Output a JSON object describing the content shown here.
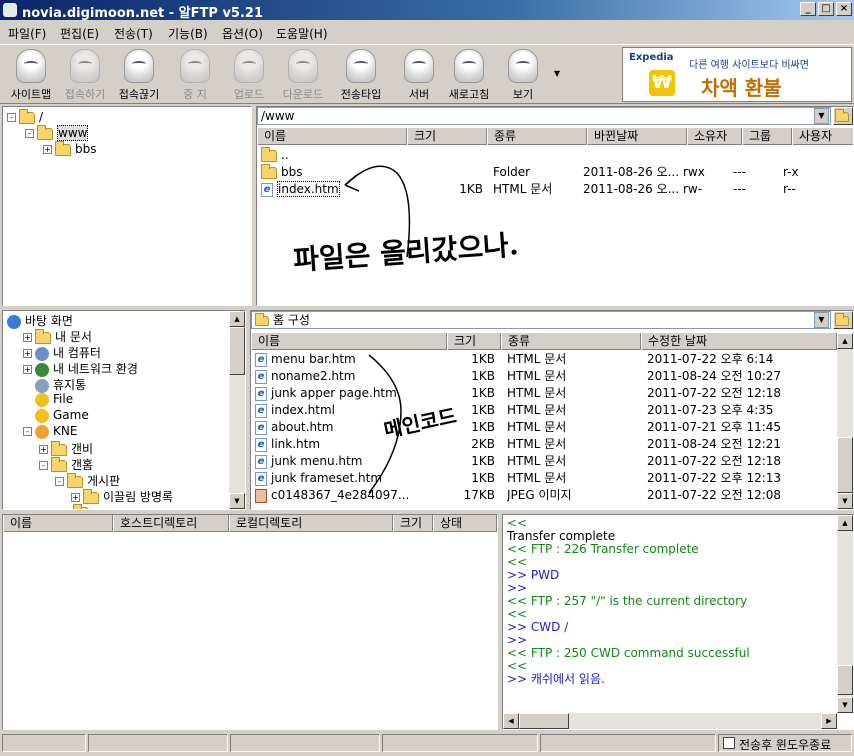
{
  "window": {
    "title": "novia.digimoon.net - 알FTP v5.21"
  },
  "menu": [
    "파일(F)",
    "편집(E)",
    "전송(T)",
    "기능(B)",
    "옵션(O)",
    "도움말(H)"
  ],
  "toolbar": [
    {
      "label": "사이트맵",
      "enabled": true
    },
    {
      "label": "접속하기",
      "enabled": false
    },
    {
      "label": "접속끊기",
      "enabled": true
    },
    {
      "label": "중 지",
      "enabled": false
    },
    {
      "label": "업로드",
      "enabled": false
    },
    {
      "label": "다운로드",
      "enabled": false
    },
    {
      "label": "전송타입",
      "enabled": true
    },
    {
      "label": "서버",
      "enabled": true
    },
    {
      "label": "새로고침",
      "enabled": true
    },
    {
      "label": "보기",
      "enabled": true
    }
  ],
  "ad": {
    "brand": "Expedia",
    "tagline": "다른 여행 사이트보다 비싸면",
    "headline": "차액 환불",
    "symbol": "₩"
  },
  "remote_tree": [
    {
      "label": "/",
      "level": 0,
      "expander": "-"
    },
    {
      "label": "www",
      "level": 1,
      "expander": "-"
    },
    {
      "label": "bbs",
      "level": 2,
      "expander": "+"
    }
  ],
  "remote": {
    "path": "/www",
    "columns": [
      "이름",
      "크기",
      "종류",
      "바뀐날짜",
      "소유자",
      "그룹",
      "사용자"
    ],
    "files": [
      {
        "name": "..",
        "size": "",
        "type": "",
        "date": "",
        "owner": "",
        "group": "",
        "user": "",
        "icon": "folder"
      },
      {
        "name": "bbs",
        "size": "",
        "type": "Folder",
        "date": "2011-08-26 오...",
        "owner": "rwx",
        "group": "---",
        "user": "r-x",
        "icon": "folder"
      },
      {
        "name": "index.htm",
        "size": "1KB",
        "type": "HTML 문서",
        "date": "2011-08-26 오...",
        "owner": "rw-",
        "group": "---",
        "user": "r--",
        "icon": "htm"
      }
    ],
    "annotation": "파일은 올리갔으나."
  },
  "local_tree": [
    {
      "label": "바탕 화면",
      "level": 0,
      "expander": "",
      "icon": "desktop"
    },
    {
      "label": "내 문서",
      "level": 1,
      "expander": "+",
      "icon": "folder"
    },
    {
      "label": "내 컴퓨터",
      "level": 1,
      "expander": "+",
      "icon": "computer"
    },
    {
      "label": "내 네트워크 환경",
      "level": 1,
      "expander": "+",
      "icon": "network"
    },
    {
      "label": "휴지통",
      "level": 1,
      "expander": "",
      "icon": "trash"
    },
    {
      "label": "File",
      "level": 1,
      "expander": "",
      "icon": "star"
    },
    {
      "label": "Game",
      "level": 1,
      "expander": "",
      "icon": "star"
    },
    {
      "label": "KNE",
      "level": 1,
      "expander": "-",
      "icon": "user"
    },
    {
      "label": "갠비",
      "level": 2,
      "expander": "+",
      "icon": "folder"
    },
    {
      "label": "갠홈",
      "level": 2,
      "expander": "-",
      "icon": "folder"
    },
    {
      "label": "게시판",
      "level": 3,
      "expander": "-",
      "icon": "folder"
    },
    {
      "label": "이끌림 방명록",
      "level": 4,
      "expander": "+",
      "icon": "folder"
    }
  ],
  "local": {
    "path": "홈 구성",
    "columns": [
      "이름",
      "크기",
      "종류",
      "수정한 날짜"
    ],
    "files": [
      {
        "name": "menu bar.htm",
        "size": "1KB",
        "type": "HTML 문서",
        "date": "2011-07-22 오후 6:14",
        "icon": "htm"
      },
      {
        "name": "noname2.htm",
        "size": "1KB",
        "type": "HTML 문서",
        "date": "2011-08-24 오전 10:27",
        "icon": "htm"
      },
      {
        "name": "junk apper page.htm",
        "size": "1KB",
        "type": "HTML 문서",
        "date": "2011-07-22 오전 12:18",
        "icon": "htm"
      },
      {
        "name": "index.html",
        "size": "1KB",
        "type": "HTML 문서",
        "date": "2011-07-23 오후 4:35",
        "icon": "htm"
      },
      {
        "name": "about.htm",
        "size": "1KB",
        "type": "HTML 문서",
        "date": "2011-07-21 오후 11:45",
        "icon": "htm"
      },
      {
        "name": "link.htm",
        "size": "2KB",
        "type": "HTML 문서",
        "date": "2011-08-24 오전 12:21",
        "icon": "htm"
      },
      {
        "name": "junk menu.htm",
        "size": "1KB",
        "type": "HTML 문서",
        "date": "2011-07-22 오전 12:18",
        "icon": "htm"
      },
      {
        "name": "junk frameset.htm",
        "size": "1KB",
        "type": "HTML 문서",
        "date": "2011-07-22 오후 12:13",
        "icon": "htm"
      },
      {
        "name": "c0148367_4e284097...",
        "size": "17KB",
        "type": "JPEG 이미지",
        "date": "2011-07-22 오전 12:08",
        "icon": "jpg"
      }
    ],
    "annotation": "메인코드"
  },
  "queue": {
    "columns": [
      "이름",
      "호스트디렉토리",
      "로컬디렉토리",
      "크기",
      "상태"
    ]
  },
  "log": [
    {
      "text": "<<",
      "color": "green"
    },
    {
      "text": "Transfer complete",
      "color": "black"
    },
    {
      "text": "<< FTP : 226 Transfer complete",
      "color": "green"
    },
    {
      "text": "<<",
      "color": "green"
    },
    {
      "text": ">> PWD",
      "color": "blue"
    },
    {
      "text": ">>",
      "color": "blue"
    },
    {
      "text": "<< FTP : 257 \"/\" is the current directory",
      "color": "green"
    },
    {
      "text": "<<",
      "color": "green"
    },
    {
      "text": ">> CWD /",
      "color": "blue"
    },
    {
      "text": ">>",
      "color": "blue"
    },
    {
      "text": "<< FTP : 250 CWD command successful",
      "color": "green"
    },
    {
      "text": "<<",
      "color": "green"
    },
    {
      "text": ">> 캐쉬에서 읽음.",
      "color": "blue"
    }
  ],
  "status": {
    "close_after_transfer": "전송후 윈도우종료",
    "close_after_transfer_checked": false
  }
}
